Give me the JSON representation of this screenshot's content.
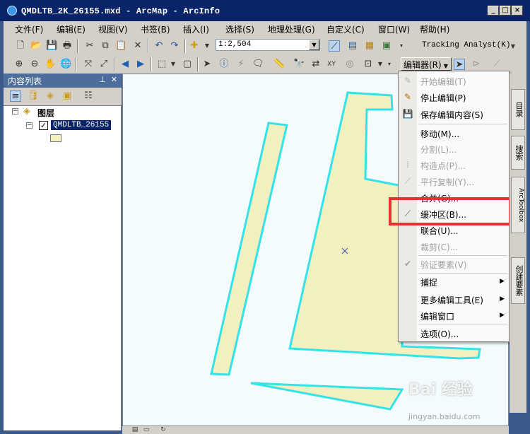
{
  "window": {
    "title": "QMDLTB_2K_26155.mxd - ArcMap - ArcInfo",
    "minimize": "_",
    "maximize": "□",
    "close": "×"
  },
  "menubar": {
    "items": [
      "文件(F)",
      "编辑(E)",
      "视图(V)",
      "书签(B)",
      "插入(I)",
      "选择(S)",
      "地理处理(G)",
      "自定义(C)",
      "窗口(W)",
      "帮助(H)"
    ]
  },
  "toolbar": {
    "scale": "1:2,504",
    "tracking_label": "Tracking Analyst(K)",
    "editor_label": "编辑器(R)"
  },
  "toc": {
    "title": "内容列表",
    "layers_root": "图层",
    "layer_name": "QMDLTB_26155",
    "layer_checked": true
  },
  "editor_menu": {
    "items": [
      {
        "label": "开始编辑(T)",
        "disabled": true,
        "icon": "pencil-icon"
      },
      {
        "label": "停止编辑(P)",
        "disabled": false,
        "icon": "pencil-stop-icon"
      },
      {
        "label": "保存编辑内容(S)",
        "disabled": false,
        "icon": "save-icon"
      },
      {
        "label": "移动(M)...",
        "disabled": false,
        "icon": ""
      },
      {
        "label": "分割(L)...",
        "disabled": true,
        "icon": ""
      },
      {
        "label": "构造点(P)...",
        "disabled": true,
        "icon": "construct-points-icon"
      },
      {
        "label": "平行复制(Y)...",
        "disabled": true,
        "icon": "copy-parallel-icon"
      },
      {
        "label": "合并(G)...",
        "disabled": false,
        "icon": ""
      },
      {
        "label": "缓冲区(B)...",
        "disabled": false,
        "icon": "buffer-icon"
      },
      {
        "label": "联合(U)...",
        "disabled": false,
        "icon": ""
      },
      {
        "label": "裁剪(C)...",
        "disabled": true,
        "icon": ""
      },
      {
        "label": "验证要素(V)",
        "disabled": true,
        "icon": "validate-icon"
      },
      {
        "label": "捕捉",
        "disabled": false,
        "submenu": true
      },
      {
        "label": "更多编辑工具(E)",
        "disabled": false,
        "submenu": true
      },
      {
        "label": "编辑窗口",
        "disabled": false,
        "submenu": true
      },
      {
        "label": "选项(O)...",
        "disabled": false,
        "icon": ""
      }
    ]
  },
  "side_tabs": [
    "目录",
    "搜索",
    "ArcToolbox",
    "创建要素"
  ],
  "watermark": {
    "main": "Bai 经验",
    "sub": "jingyan.baidu.com"
  },
  "colors": {
    "title_bar": "#0a246a",
    "polygon_fill": "#f3f0c0",
    "polygon_outline": "#33e3e8",
    "highlight": "#e23232",
    "map_bg": "#f4fbfd"
  }
}
